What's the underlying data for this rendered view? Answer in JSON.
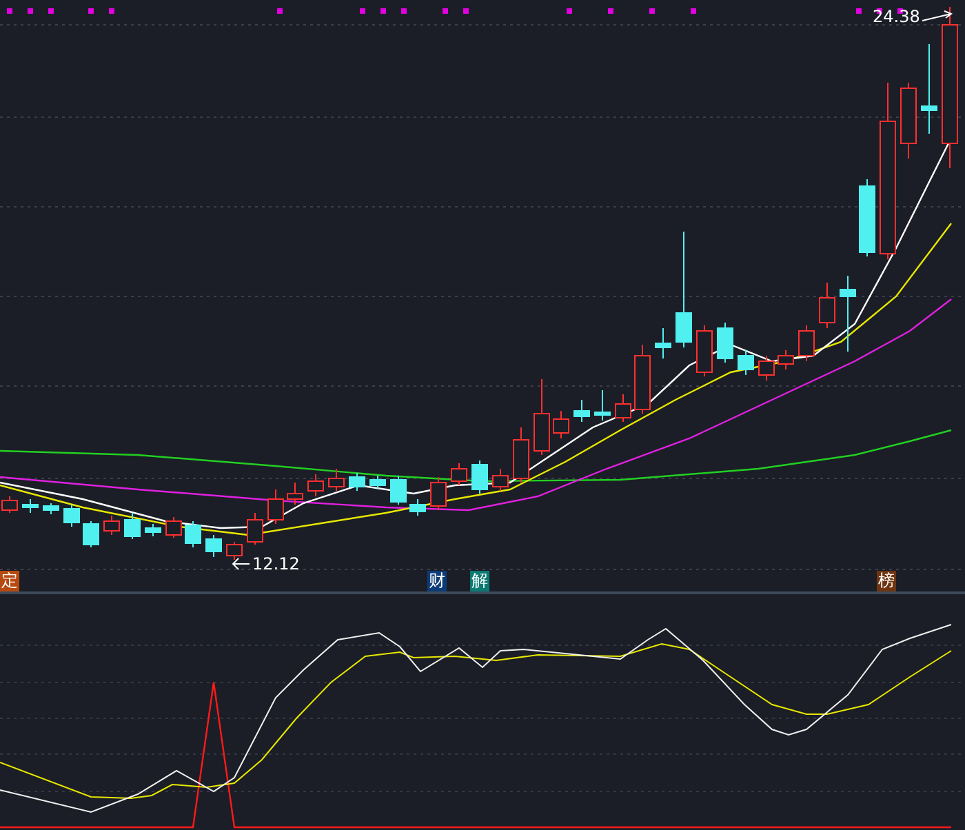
{
  "price_chart": {
    "high_label": "24.38",
    "low_label": "12.12",
    "event_markers": [
      {
        "label": "定",
        "color": "#b84a10"
      },
      {
        "label": "财",
        "color": "#0c3c78"
      },
      {
        "label": "解",
        "color": "#0a7a72"
      },
      {
        "label": "榜",
        "color": "#6e3410"
      }
    ]
  }
}
